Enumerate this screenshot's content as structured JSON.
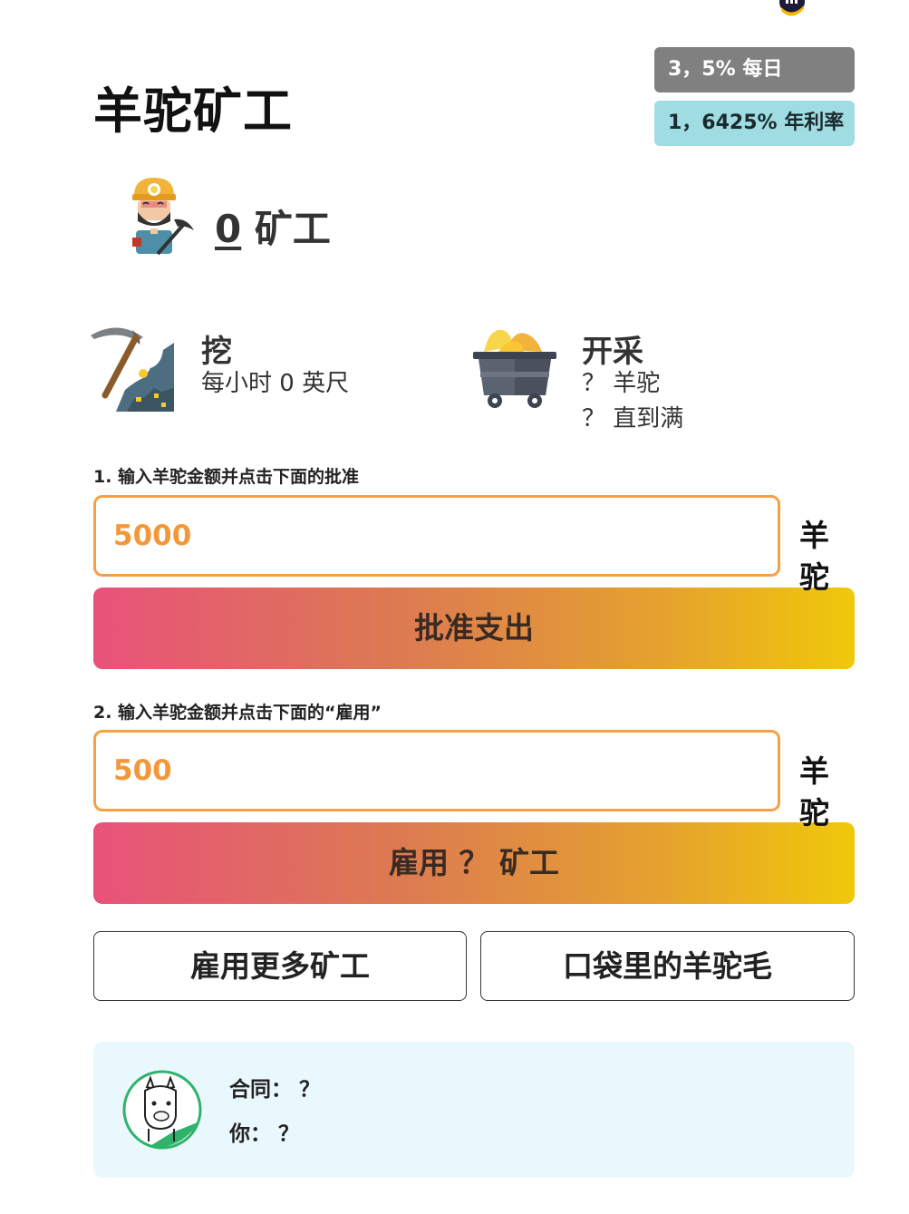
{
  "header": {
    "title": "羊驼矿工",
    "daily_rate": "3，5% 每日",
    "annual_rate": "1，6425% 年利率"
  },
  "miners": {
    "count": "0",
    "label": "矿工"
  },
  "dig": {
    "title": "挖",
    "rate": "每小时 0 英尺"
  },
  "mine": {
    "title": "开采",
    "line1": "？ 羊驼",
    "line2": "？ 直到满"
  },
  "step1": {
    "label": "1. 输入羊驼金额并点击下面的批准",
    "amount": "5000",
    "unit": "羊驼",
    "button": "批准支出"
  },
  "step2": {
    "label": "2. 输入羊驼金额并点击下面的“雇用”",
    "amount": "500",
    "unit": "羊驼",
    "button": "雇用 ？ 矿工"
  },
  "actions": {
    "hire_more": "雇用更多矿工",
    "pocket": "口袋里的羊驼毛"
  },
  "info": {
    "contract": "合同： ？",
    "you": "你： ？"
  },
  "colors": {
    "input_border": "#f6a043",
    "gradient_start": "#e8527a",
    "gradient_end": "#f0c80a",
    "card_bg": "#e9f8fd",
    "rate_daily_bg": "#808080",
    "rate_yearly_bg": "#9fdde3"
  },
  "icons": {
    "top": "logo-icon",
    "miner": "miner-icon",
    "dig": "pickaxe-icon",
    "mine": "mine-cart-icon",
    "avatar": "alpaca-icon"
  }
}
